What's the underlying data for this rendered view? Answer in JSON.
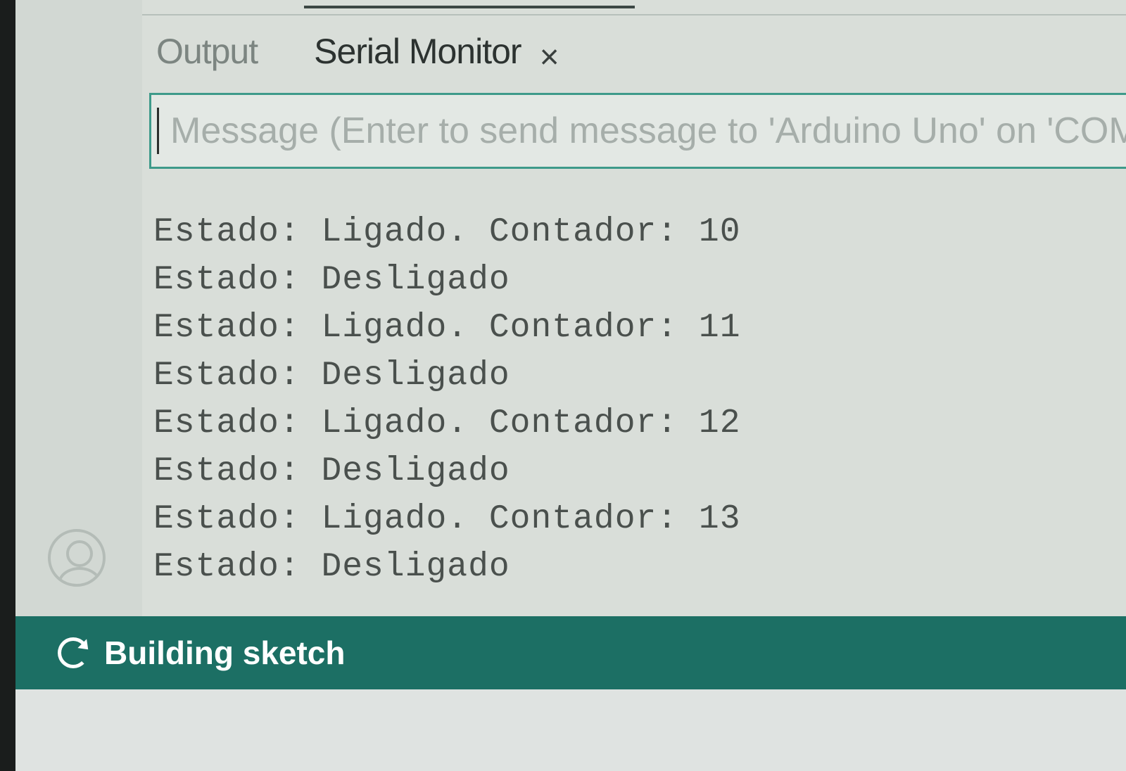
{
  "tabs": {
    "output_label": "Output",
    "serial_monitor_label": "Serial Monitor",
    "close_glyph": "×"
  },
  "message_input": {
    "placeholder": "Message (Enter to send message to 'Arduino Uno' on 'COM",
    "value": ""
  },
  "serial_output": [
    "Estado: Ligado. Contador: 10",
    "Estado: Desligado",
    "Estado: Ligado. Contador: 11",
    "Estado: Desligado",
    "Estado: Ligado. Contador: 12",
    "Estado: Desligado",
    "Estado: Ligado. Contador: 13",
    "Estado: Desligado"
  ],
  "status_bar": {
    "text": "Building sketch",
    "icon": "sync-icon",
    "color": "#1c6f64"
  },
  "colors": {
    "accent": "#3e9a8a",
    "status_bar": "#1c6f64",
    "panel_bg": "#d9ded9"
  }
}
